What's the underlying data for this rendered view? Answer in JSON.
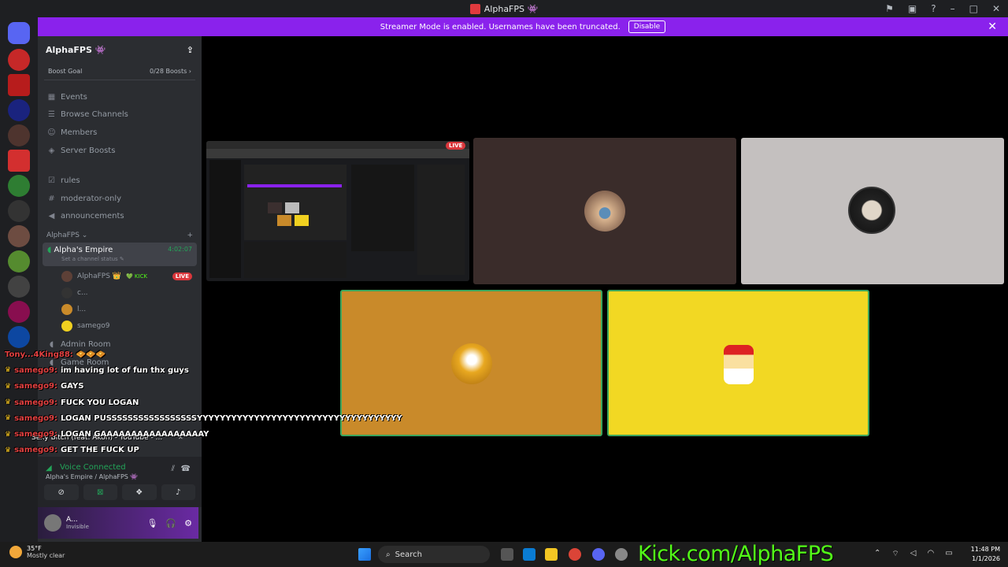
{
  "window": {
    "title": "AlphaFPS 👾"
  },
  "banner": {
    "text": "Streamer Mode is enabled. Usernames have been truncated.",
    "button": "Disable"
  },
  "server": {
    "name": "AlphaFPS 👾",
    "boost_goal_label": "Boost Goal",
    "boost_count": "0/28 Boosts ›"
  },
  "nav": [
    {
      "label": "Events",
      "icon": "calendar-icon"
    },
    {
      "label": "Browse Channels",
      "icon": "list-icon"
    },
    {
      "label": "Members",
      "icon": "members-icon"
    },
    {
      "label": "Server Boosts",
      "icon": "boost-icon"
    }
  ],
  "channels": [
    {
      "label": "rules",
      "icon": "check-icon"
    },
    {
      "label": "moderator-only",
      "icon": "hash-icon"
    },
    {
      "label": "announcements",
      "icon": "megaphone-icon"
    }
  ],
  "category": {
    "label": "AlphaFPS ⌄",
    "add": "+"
  },
  "voice_channel": {
    "name": "Alpha's Empire",
    "timer": "4:02:07",
    "status": "Set a channel status ✎"
  },
  "voice_users": [
    {
      "name": "AlphaFPS 👑",
      "tag": "💚 KICK",
      "live": "LIVE"
    },
    {
      "name": "c..."
    },
    {
      "name": "l..."
    },
    {
      "name": "samego9"
    }
  ],
  "chat": [
    {
      "user": "Tony...4King88:",
      "msg": "🧇🧇🧇"
    },
    {
      "user": "samego9:",
      "msg": "im having lot of fun thx guys"
    },
    {
      "user": "samego9:",
      "msg": "GAYS"
    },
    {
      "user": "samego9:",
      "msg": "FUCK YOU LOGAN"
    },
    {
      "user": "samego9:",
      "msg": "LOGAN PUSSSSSSSSSSSSSSSSSYYYYYYYYYYYYYYYYYYYYYYYYYYYYYYYYYYYY"
    },
    {
      "user": "samego9:",
      "msg": "LOGAN GAAAAAAAAAAAAAAAAAY"
    },
    {
      "user": "samego9:",
      "msg": "GET THE FUCK UP"
    }
  ],
  "background_rows": {
    "admin_room": "Admin Room",
    "game_room": "Game Room",
    "music": "Sexy Bitch (feat. Akon) - YouTube - ..."
  },
  "voice_panel": {
    "title": "Voice Connected",
    "subtitle": "Alpha's Empire / AlphaFPS 👾"
  },
  "user_panel": {
    "name": "A...",
    "status": "Invisible"
  },
  "tiles": {
    "live_tag": "LIVE"
  },
  "taskbar": {
    "temp": "35°F",
    "weather": "Mostly clear",
    "search": "Search",
    "kick_url": "Kick.com/AlphaFPS",
    "time": "11:48 PM",
    "date": "1/1/2026"
  },
  "colors": {
    "accent": "#8a22ec",
    "kick_green": "#53fc18",
    "live_red": "#da373c",
    "voice_green": "#23a559"
  }
}
